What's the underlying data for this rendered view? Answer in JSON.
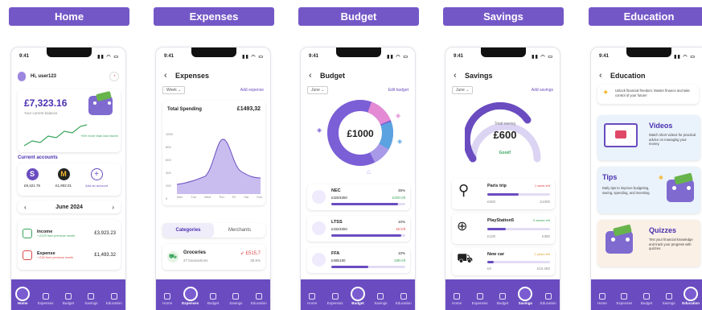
{
  "labels": [
    "Home",
    "Expenses",
    "Budget",
    "Savings",
    "Education"
  ],
  "status": {
    "time": "9:41"
  },
  "nav": [
    "Home",
    "Expenses",
    "Budget",
    "Savings",
    "Education"
  ],
  "home": {
    "greeting": "Hi, user123",
    "balance": "£7,323.16",
    "balance_label": "Your current balance",
    "trend": "+6% more than last month",
    "accounts_title": "Current accounts",
    "accounts": [
      {
        "amount": "£9,421.76"
      },
      {
        "amount": "£1,902.01"
      },
      {
        "amount": "Add an account"
      }
    ],
    "month": "June 2024",
    "rows": [
      {
        "title": "Income",
        "sub": "+ £120 from previous month",
        "amount": "£3,923.23",
        "color": "#3aa55c"
      },
      {
        "title": "Expense",
        "sub": "+ £35 from previous month",
        "amount": "£1,493.32",
        "color": "#e04848"
      }
    ]
  },
  "expenses": {
    "title": "Expenses",
    "period": "Week",
    "add": "Add expense",
    "total_label": "Total Spending",
    "total": "£1493,32",
    "yticks": [
      "1000",
      "800",
      "600",
      "400",
      "200",
      "0"
    ],
    "days": [
      "Mon",
      "Tue",
      "Wed",
      "Thu",
      "Fri",
      "Sat",
      "Sun"
    ],
    "tabs": [
      "Categories",
      "Merchants"
    ],
    "item": {
      "name": "Groceries",
      "sub": "27 transactions",
      "amount": "↙ £515,7",
      "sub2": "35.5%"
    }
  },
  "budget": {
    "title": "Budget",
    "period": "June",
    "edit": "Edit budget",
    "total": "£1000",
    "items": [
      {
        "name": "NEC",
        "pct": "35%",
        "spent": "£320/£350",
        "left": "£300 left",
        "left_color": "#3aa55c",
        "fill": 0.9
      },
      {
        "name": "LTSS",
        "pct": "10%",
        "spent": "£332/£350",
        "left": "£6 left",
        "left_color": "#e04848",
        "fill": 0.95
      },
      {
        "name": "FFA",
        "pct": "10%",
        "spent": "£48/£100",
        "left": "£89 left",
        "left_color": "#3aa55c",
        "fill": 0.5
      }
    ]
  },
  "savings": {
    "title": "Savings",
    "period": "June",
    "add": "Add savings",
    "label": "Total saving",
    "total": "£600",
    "status": "Good!",
    "goals": [
      {
        "name": "Paris trip",
        "tag": "1 week left",
        "low": "£500",
        "high": "£1000",
        "fill": 0.5
      },
      {
        "name": "PlayStation5",
        "tag": "5 weeks left",
        "low": "£100",
        "high": "£380",
        "fill": 0.3
      },
      {
        "name": "New car",
        "tag": "2 years left",
        "low": "£0",
        "high": "£10,282",
        "fill": 0.1
      }
    ]
  },
  "education": {
    "title": "Education",
    "banner": "Unlock financial freedom: Master finance and take control of your future!",
    "cards": [
      {
        "title": "Videos",
        "desc": "Watch short videos for practical advice on managing your money."
      },
      {
        "title": "Tips",
        "desc": "Daily tips to improve budgeting, saving, spending, and investing."
      },
      {
        "title": "Quizzes",
        "desc": "Test your financial knowledge and track your progress with quizzes."
      }
    ]
  }
}
